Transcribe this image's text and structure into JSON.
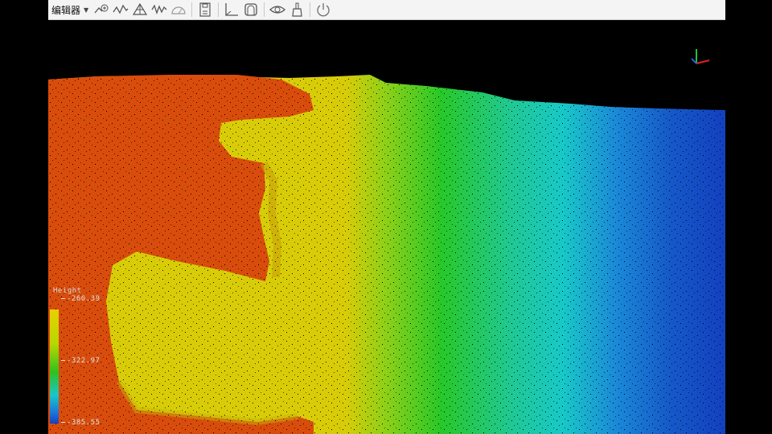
{
  "toolbar": {
    "menu_label": "编辑器",
    "icons": [
      "add-point-icon",
      "profile-line-icon",
      "triangulate-icon",
      "waveform-icon",
      "half-circle-icon",
      "save-icon",
      "axis-icon",
      "cylinder-icon",
      "eye-icon",
      "brush-icon",
      "power-icon"
    ]
  },
  "legend": {
    "title": "Height",
    "max": "-260.39",
    "mid": "-322.97",
    "min": "-385.55"
  },
  "colors": {
    "high": "#d84c0c",
    "upper": "#d8cc08",
    "mid": "#28c828",
    "low": "#18c8c8",
    "deep": "#1440c0"
  }
}
